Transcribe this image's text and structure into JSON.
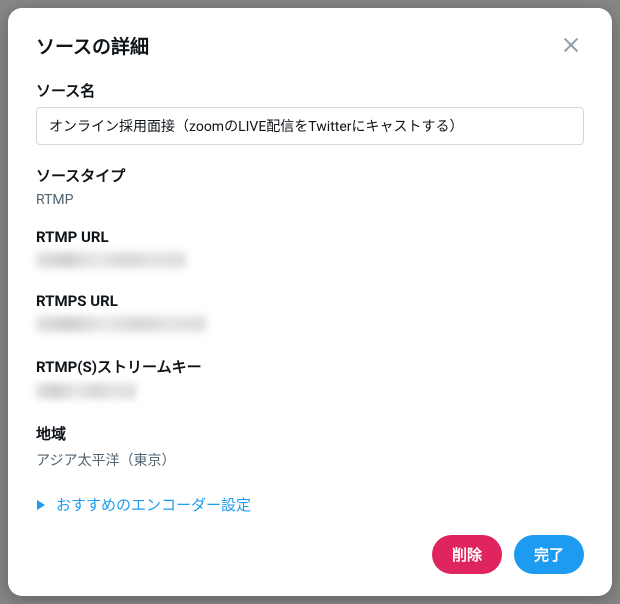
{
  "modal": {
    "title": "ソースの詳細"
  },
  "fields": {
    "source_name": {
      "label": "ソース名",
      "value": "オンライン採用面接（zoomのLIVE配信をTwitterにキャストする）"
    },
    "source_type": {
      "label": "ソースタイプ",
      "value": "RTMP"
    },
    "rtmp_url": {
      "label": "RTMP URL"
    },
    "rtmps_url": {
      "label": "RTMPS URL"
    },
    "stream_key": {
      "label": "RTMP(S)ストリームキー"
    },
    "region": {
      "label": "地域",
      "value": "アジア太平洋（東京）"
    }
  },
  "expand": {
    "label": "おすすめのエンコーダー設定"
  },
  "buttons": {
    "delete": "削除",
    "done": "完了"
  }
}
